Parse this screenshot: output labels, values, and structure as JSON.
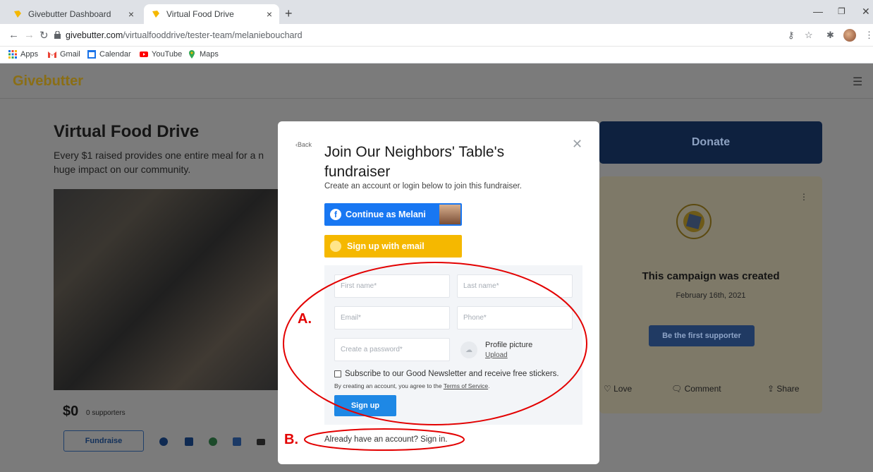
{
  "browser": {
    "tabs": [
      {
        "title": "Givebutter Dashboard",
        "close": "×"
      },
      {
        "title": "Virtual Food Drive",
        "close": "×"
      }
    ],
    "new_tab": "+",
    "url_host": "givebutter.com",
    "url_path": "/virtualfooddrive/tester-team/melaniebouchard",
    "bookmarks": [
      "Apps",
      "Gmail",
      "Calendar",
      "YouTube",
      "Maps"
    ]
  },
  "site": {
    "logo": "Givebutter"
  },
  "campaign": {
    "title": "Virtual Food Drive",
    "description": "Every $1 raised provides one entire meal for a n huge impact on our community.",
    "amount": "$0",
    "supporters": "0 supporters",
    "fundraise_label": "Fundraise",
    "donate_label": "Donate",
    "card_title": "This campaign was created",
    "card_date": "February 16th, 2021",
    "first_supporter_label": "Be the first supporter",
    "actions": {
      "love": "Love",
      "comment": "Comment",
      "share": "Share"
    }
  },
  "modal": {
    "back": "Back",
    "title": "Join Our Neighbors' Table's fundraiser",
    "subtitle": "Create an account or login below to join this fundraiser.",
    "facebook_label": "Continue as Melani",
    "email_label": "Sign up with email",
    "fields": {
      "first_name": "First name*",
      "last_name": "Last name*",
      "email": "Email*",
      "phone": "Phone*",
      "password": "Create a password*"
    },
    "profile_picture": "Profile picture",
    "upload": "Upload",
    "newsletter": "Subscribe to our Good Newsletter and receive free stickers.",
    "terms_prefix": "By creating an account, you agree to the ",
    "terms_link": "Terms of Service",
    "terms_suffix": ".",
    "signup_label": "Sign up",
    "already": "Already have an account? Sign in."
  },
  "annotations": {
    "a": "A.",
    "b": "B.",
    "color": "#e30000"
  }
}
